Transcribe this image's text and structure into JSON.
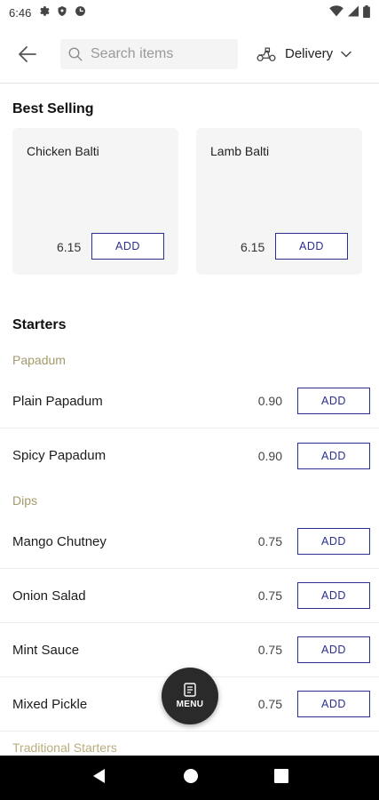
{
  "status_bar": {
    "time": "6:46",
    "left_icons": [
      "gear-icon",
      "shield-icon",
      "data-saver-icon"
    ],
    "right_icons": [
      "wifi-icon",
      "signal-icon",
      "battery-icon"
    ]
  },
  "header": {
    "search_placeholder": "Search items",
    "delivery_label": "Delivery"
  },
  "best_selling": {
    "title": "Best Selling",
    "items": [
      {
        "name": "Chicken Balti",
        "price": "6.15",
        "add_label": "ADD"
      },
      {
        "name": "Lamb Balti",
        "price": "6.15",
        "add_label": "ADD"
      }
    ]
  },
  "starters": {
    "title": "Starters",
    "groups": [
      {
        "name": "Papadum",
        "items": [
          {
            "name": "Plain Papadum",
            "price": "0.90",
            "add_label": "ADD"
          },
          {
            "name": "Spicy Papadum",
            "price": "0.90",
            "add_label": "ADD"
          }
        ]
      },
      {
        "name": "Dips",
        "items": [
          {
            "name": "Mango Chutney",
            "price": "0.75",
            "add_label": "ADD"
          },
          {
            "name": "Onion Salad",
            "price": "0.75",
            "add_label": "ADD"
          },
          {
            "name": "Mint Sauce",
            "price": "0.75",
            "add_label": "ADD"
          },
          {
            "name": "Mixed Pickle",
            "price": "0.75",
            "add_label": "ADD"
          }
        ]
      }
    ],
    "next_group": "Traditional Starters"
  },
  "menu_fab": {
    "label": "MENU"
  },
  "colors": {
    "accent": "#2b2f8f",
    "subheading": "#a49a6c",
    "card_bg": "#f5f5f5",
    "fab_bg": "#2a2a2a"
  }
}
